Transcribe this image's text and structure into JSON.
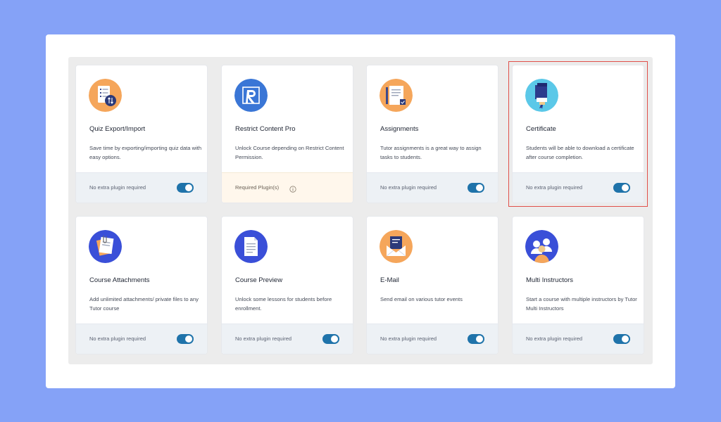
{
  "cards": [
    {
      "title": "Quiz Export/Import",
      "desc": "Save time by exporting/importing quiz data with easy options.",
      "footer": "No extra plugin required",
      "toggle_on": true
    },
    {
      "title": "Restrict Content Pro",
      "desc": "Unlock Course depending on Restrict Content Permission.",
      "footer": "Required Plugin(s)",
      "toggle_on": null
    },
    {
      "title": "Assignments",
      "desc": "Tutor assignments is a great way to assign tasks to students.",
      "footer": "No extra plugin required",
      "toggle_on": true
    },
    {
      "title": "Certificate",
      "desc": "Students will be able to download a certificate after course completion.",
      "footer": "No extra plugin required",
      "toggle_on": true
    },
    {
      "title": "Course Attachments",
      "desc": "Add unlimited attachments/ private files to any Tutor course",
      "footer": "No extra plugin required",
      "toggle_on": true
    },
    {
      "title": "Course Preview",
      "desc": "Unlock some lessons for students before enrollment.",
      "footer": "No extra plugin required",
      "toggle_on": true
    },
    {
      "title": "E-Mail",
      "desc": "Send email on various tutor events",
      "footer": "No extra plugin required",
      "toggle_on": true
    },
    {
      "title": "Multi Instructors",
      "desc": "Start a course with multiple instructors by Tutor Multi Instructors",
      "footer": "No extra plugin required",
      "toggle_on": true
    }
  ],
  "icons": [
    "quiz-export-import-icon",
    "restrict-content-pro-icon",
    "assignments-icon",
    "certificate-icon",
    "course-attachments-icon",
    "course-preview-icon",
    "email-icon",
    "multi-instructors-icon"
  ],
  "colors": {
    "background": "#85a2f7",
    "toggle": "#1f73aa",
    "highlight": "#e0504a",
    "required_footer": "#fff7ec"
  }
}
